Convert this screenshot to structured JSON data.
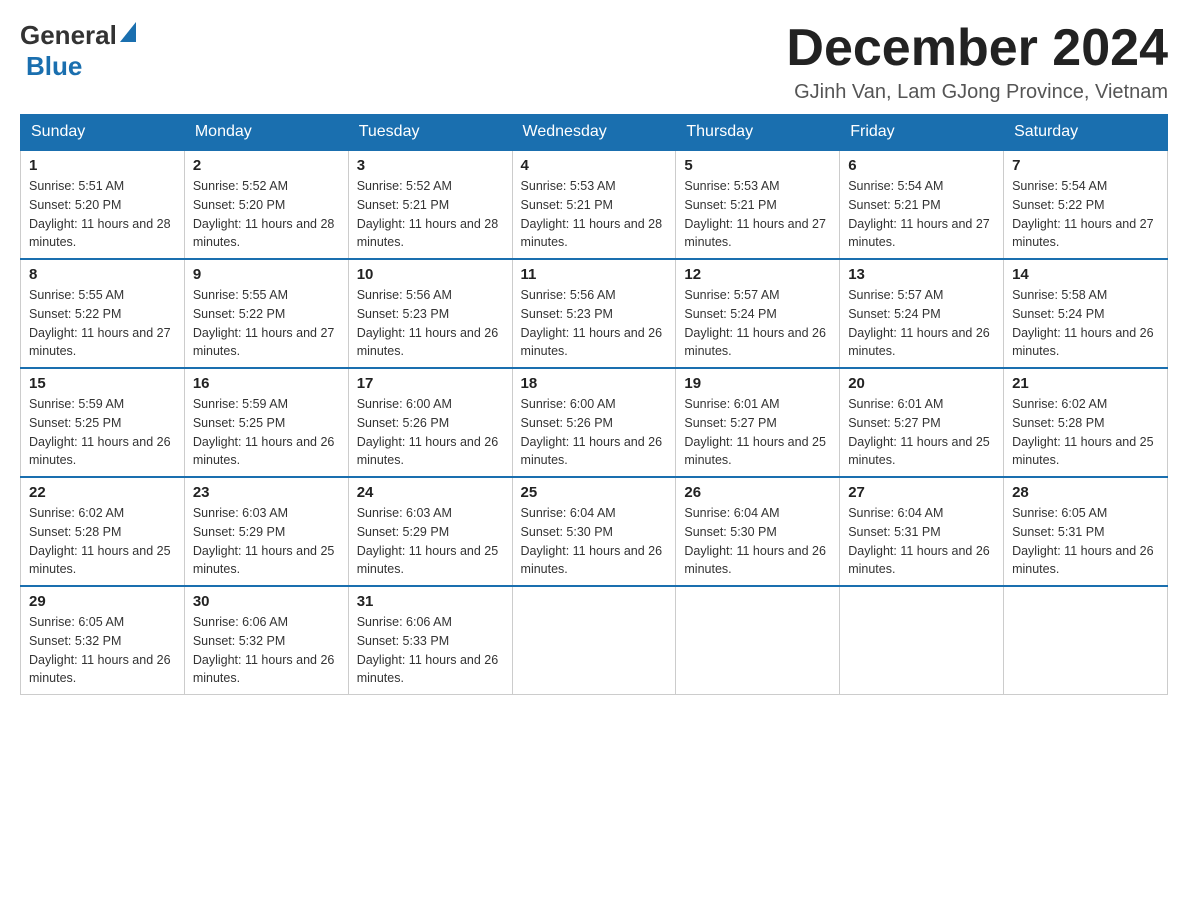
{
  "header": {
    "logo_general": "General",
    "logo_blue": "Blue",
    "main_title": "December 2024",
    "subtitle": "GJinh Van, Lam GJong Province, Vietnam"
  },
  "days_of_week": [
    "Sunday",
    "Monday",
    "Tuesday",
    "Wednesday",
    "Thursday",
    "Friday",
    "Saturday"
  ],
  "weeks": [
    [
      {
        "day": "1",
        "sunrise": "Sunrise: 5:51 AM",
        "sunset": "Sunset: 5:20 PM",
        "daylight": "Daylight: 11 hours and 28 minutes."
      },
      {
        "day": "2",
        "sunrise": "Sunrise: 5:52 AM",
        "sunset": "Sunset: 5:20 PM",
        "daylight": "Daylight: 11 hours and 28 minutes."
      },
      {
        "day": "3",
        "sunrise": "Sunrise: 5:52 AM",
        "sunset": "Sunset: 5:21 PM",
        "daylight": "Daylight: 11 hours and 28 minutes."
      },
      {
        "day": "4",
        "sunrise": "Sunrise: 5:53 AM",
        "sunset": "Sunset: 5:21 PM",
        "daylight": "Daylight: 11 hours and 28 minutes."
      },
      {
        "day": "5",
        "sunrise": "Sunrise: 5:53 AM",
        "sunset": "Sunset: 5:21 PM",
        "daylight": "Daylight: 11 hours and 27 minutes."
      },
      {
        "day": "6",
        "sunrise": "Sunrise: 5:54 AM",
        "sunset": "Sunset: 5:21 PM",
        "daylight": "Daylight: 11 hours and 27 minutes."
      },
      {
        "day": "7",
        "sunrise": "Sunrise: 5:54 AM",
        "sunset": "Sunset: 5:22 PM",
        "daylight": "Daylight: 11 hours and 27 minutes."
      }
    ],
    [
      {
        "day": "8",
        "sunrise": "Sunrise: 5:55 AM",
        "sunset": "Sunset: 5:22 PM",
        "daylight": "Daylight: 11 hours and 27 minutes."
      },
      {
        "day": "9",
        "sunrise": "Sunrise: 5:55 AM",
        "sunset": "Sunset: 5:22 PM",
        "daylight": "Daylight: 11 hours and 27 minutes."
      },
      {
        "day": "10",
        "sunrise": "Sunrise: 5:56 AM",
        "sunset": "Sunset: 5:23 PM",
        "daylight": "Daylight: 11 hours and 26 minutes."
      },
      {
        "day": "11",
        "sunrise": "Sunrise: 5:56 AM",
        "sunset": "Sunset: 5:23 PM",
        "daylight": "Daylight: 11 hours and 26 minutes."
      },
      {
        "day": "12",
        "sunrise": "Sunrise: 5:57 AM",
        "sunset": "Sunset: 5:24 PM",
        "daylight": "Daylight: 11 hours and 26 minutes."
      },
      {
        "day": "13",
        "sunrise": "Sunrise: 5:57 AM",
        "sunset": "Sunset: 5:24 PM",
        "daylight": "Daylight: 11 hours and 26 minutes."
      },
      {
        "day": "14",
        "sunrise": "Sunrise: 5:58 AM",
        "sunset": "Sunset: 5:24 PM",
        "daylight": "Daylight: 11 hours and 26 minutes."
      }
    ],
    [
      {
        "day": "15",
        "sunrise": "Sunrise: 5:59 AM",
        "sunset": "Sunset: 5:25 PM",
        "daylight": "Daylight: 11 hours and 26 minutes."
      },
      {
        "day": "16",
        "sunrise": "Sunrise: 5:59 AM",
        "sunset": "Sunset: 5:25 PM",
        "daylight": "Daylight: 11 hours and 26 minutes."
      },
      {
        "day": "17",
        "sunrise": "Sunrise: 6:00 AM",
        "sunset": "Sunset: 5:26 PM",
        "daylight": "Daylight: 11 hours and 26 minutes."
      },
      {
        "day": "18",
        "sunrise": "Sunrise: 6:00 AM",
        "sunset": "Sunset: 5:26 PM",
        "daylight": "Daylight: 11 hours and 26 minutes."
      },
      {
        "day": "19",
        "sunrise": "Sunrise: 6:01 AM",
        "sunset": "Sunset: 5:27 PM",
        "daylight": "Daylight: 11 hours and 25 minutes."
      },
      {
        "day": "20",
        "sunrise": "Sunrise: 6:01 AM",
        "sunset": "Sunset: 5:27 PM",
        "daylight": "Daylight: 11 hours and 25 minutes."
      },
      {
        "day": "21",
        "sunrise": "Sunrise: 6:02 AM",
        "sunset": "Sunset: 5:28 PM",
        "daylight": "Daylight: 11 hours and 25 minutes."
      }
    ],
    [
      {
        "day": "22",
        "sunrise": "Sunrise: 6:02 AM",
        "sunset": "Sunset: 5:28 PM",
        "daylight": "Daylight: 11 hours and 25 minutes."
      },
      {
        "day": "23",
        "sunrise": "Sunrise: 6:03 AM",
        "sunset": "Sunset: 5:29 PM",
        "daylight": "Daylight: 11 hours and 25 minutes."
      },
      {
        "day": "24",
        "sunrise": "Sunrise: 6:03 AM",
        "sunset": "Sunset: 5:29 PM",
        "daylight": "Daylight: 11 hours and 25 minutes."
      },
      {
        "day": "25",
        "sunrise": "Sunrise: 6:04 AM",
        "sunset": "Sunset: 5:30 PM",
        "daylight": "Daylight: 11 hours and 26 minutes."
      },
      {
        "day": "26",
        "sunrise": "Sunrise: 6:04 AM",
        "sunset": "Sunset: 5:30 PM",
        "daylight": "Daylight: 11 hours and 26 minutes."
      },
      {
        "day": "27",
        "sunrise": "Sunrise: 6:04 AM",
        "sunset": "Sunset: 5:31 PM",
        "daylight": "Daylight: 11 hours and 26 minutes."
      },
      {
        "day": "28",
        "sunrise": "Sunrise: 6:05 AM",
        "sunset": "Sunset: 5:31 PM",
        "daylight": "Daylight: 11 hours and 26 minutes."
      }
    ],
    [
      {
        "day": "29",
        "sunrise": "Sunrise: 6:05 AM",
        "sunset": "Sunset: 5:32 PM",
        "daylight": "Daylight: 11 hours and 26 minutes."
      },
      {
        "day": "30",
        "sunrise": "Sunrise: 6:06 AM",
        "sunset": "Sunset: 5:32 PM",
        "daylight": "Daylight: 11 hours and 26 minutes."
      },
      {
        "day": "31",
        "sunrise": "Sunrise: 6:06 AM",
        "sunset": "Sunset: 5:33 PM",
        "daylight": "Daylight: 11 hours and 26 minutes."
      },
      null,
      null,
      null,
      null
    ]
  ]
}
